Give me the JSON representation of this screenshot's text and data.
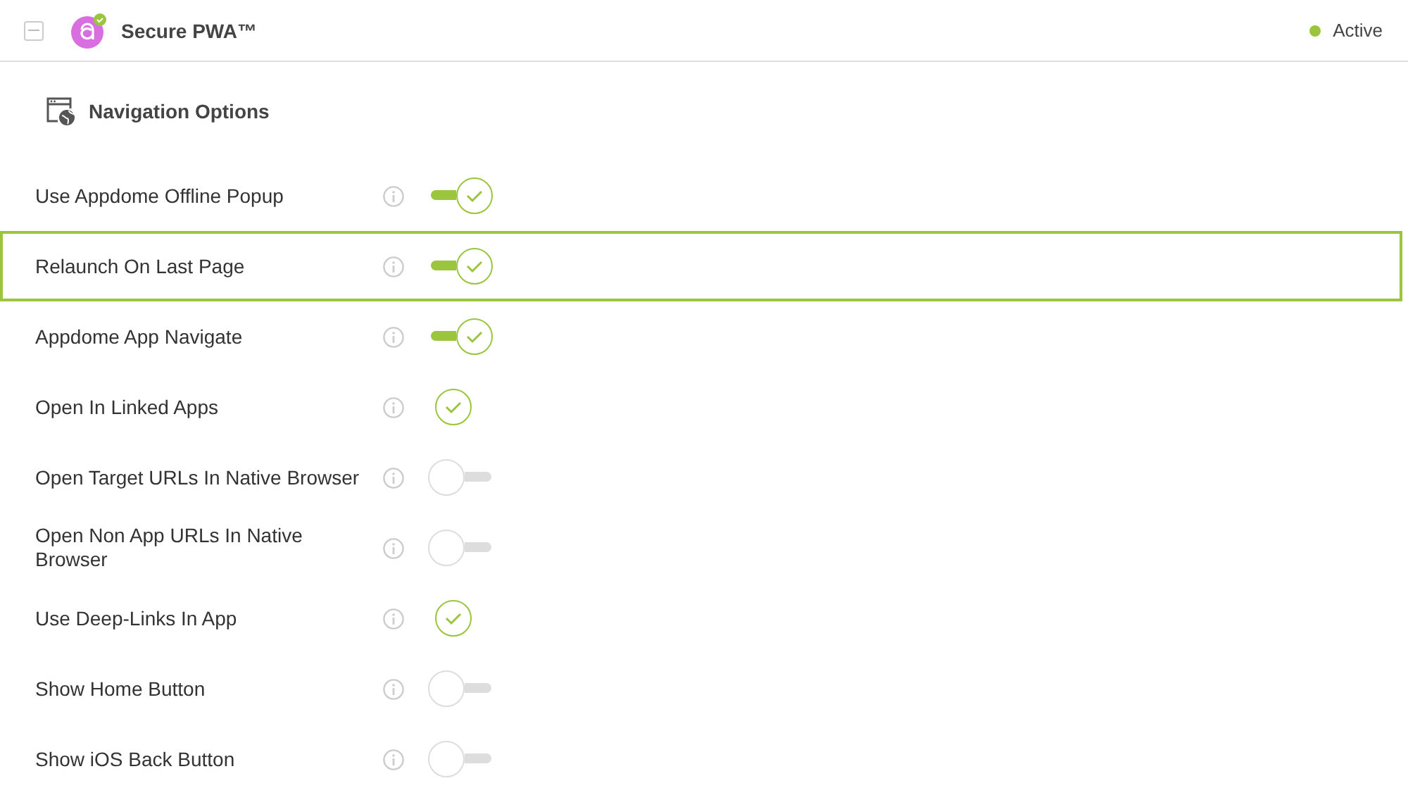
{
  "header": {
    "title": "Secure PWA™",
    "status": "Active"
  },
  "section": {
    "title": "Navigation Options"
  },
  "options": [
    {
      "label": "Use Appdome Offline Popup",
      "kind": "toggle",
      "on": true,
      "selected": false
    },
    {
      "label": "Relaunch On Last Page",
      "kind": "toggle",
      "on": true,
      "selected": true
    },
    {
      "label": "Appdome App Navigate",
      "kind": "toggle",
      "on": true,
      "selected": false
    },
    {
      "label": "Open In Linked Apps",
      "kind": "check",
      "on": true,
      "selected": false
    },
    {
      "label": "Open Target URLs In Native Browser",
      "kind": "toggle",
      "on": false,
      "selected": false
    },
    {
      "label": "Open Non App URLs In Native Browser",
      "kind": "toggle",
      "on": false,
      "selected": false
    },
    {
      "label": "Use Deep-Links In App",
      "kind": "check",
      "on": true,
      "selected": false
    },
    {
      "label": "Show Home Button",
      "kind": "toggle",
      "on": false,
      "selected": false
    },
    {
      "label": "Show iOS Back Button",
      "kind": "toggle",
      "on": false,
      "selected": false
    }
  ]
}
